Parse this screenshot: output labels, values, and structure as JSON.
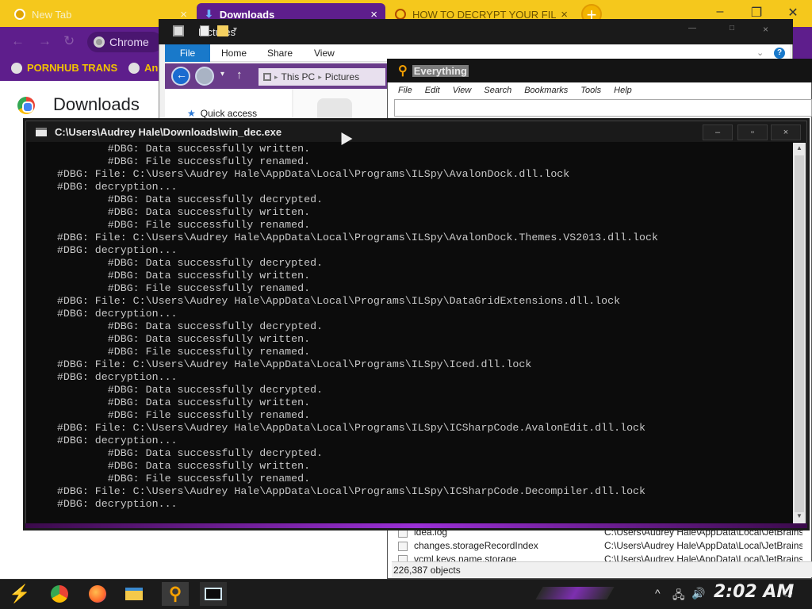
{
  "chrome": {
    "tabs": [
      {
        "label": "New Tab"
      },
      {
        "label": "Downloads"
      },
      {
        "label": "HOW TO DECRYPT YOUR FIL"
      }
    ],
    "omnibox_label": "Chrome",
    "bookmarks": [
      {
        "label": "PORNHUB TRANS"
      },
      {
        "label": "An"
      }
    ],
    "page_title": "Downloads",
    "accent_color": "#5e1e8c",
    "tabbar_color": "#f5c81c"
  },
  "explorer": {
    "title": "Pictures",
    "ribbon_tabs": [
      "File",
      "Home",
      "Share",
      "View"
    ],
    "breadcrumb": [
      "This PC",
      "Pictures"
    ],
    "nav_quick_access": "Quick access"
  },
  "everything": {
    "title": "Everything",
    "menu": [
      "File",
      "Edit",
      "View",
      "Search",
      "Bookmarks",
      "Tools",
      "Help"
    ],
    "rows": [
      {
        "name": "idea.log",
        "path": "C:\\Users\\Audrey Hale\\AppData\\Local\\JetBrains\\..."
      },
      {
        "name": "changes.storageRecordIndex",
        "path": "C:\\Users\\Audrey Hale\\AppData\\Local\\JetBrains\\..."
      },
      {
        "name": "vcml.keys.name.storage",
        "path": "C:\\Users\\Audrey Hale\\AppData\\Local\\JetBrains\\..."
      }
    ],
    "status": "226,387 objects"
  },
  "console": {
    "title": "C:\\Users\\Audrey Hale\\Downloads\\win_dec.exe",
    "buttons": {
      "minimize": "–",
      "maximize": "▫",
      "close": "×"
    },
    "lines": [
      "            #DBG: Data successfully written.",
      "            #DBG: File successfully renamed.",
      "    #DBG: File: C:\\Users\\Audrey Hale\\AppData\\Local\\Programs\\ILSpy\\AvalonDock.dll.lock",
      "    #DBG: decryption...",
      "            #DBG: Data successfully decrypted.",
      "            #DBG: Data successfully written.",
      "            #DBG: File successfully renamed.",
      "    #DBG: File: C:\\Users\\Audrey Hale\\AppData\\Local\\Programs\\ILSpy\\AvalonDock.Themes.VS2013.dll.lock",
      "    #DBG: decryption...",
      "            #DBG: Data successfully decrypted.",
      "            #DBG: Data successfully written.",
      "            #DBG: File successfully renamed.",
      "    #DBG: File: C:\\Users\\Audrey Hale\\AppData\\Local\\Programs\\ILSpy\\DataGridExtensions.dll.lock",
      "    #DBG: decryption...",
      "            #DBG: Data successfully decrypted.",
      "            #DBG: Data successfully written.",
      "            #DBG: File successfully renamed.",
      "    #DBG: File: C:\\Users\\Audrey Hale\\AppData\\Local\\Programs\\ILSpy\\Iced.dll.lock",
      "    #DBG: decryption...",
      "            #DBG: Data successfully decrypted.",
      "            #DBG: Data successfully written.",
      "            #DBG: File successfully renamed.",
      "    #DBG: File: C:\\Users\\Audrey Hale\\AppData\\Local\\Programs\\ILSpy\\ICSharpCode.AvalonEdit.dll.lock",
      "    #DBG: decryption...",
      "            #DBG: Data successfully decrypted.",
      "            #DBG: Data successfully written.",
      "            #DBG: File successfully renamed.",
      "    #DBG: File: C:\\Users\\Audrey Hale\\AppData\\Local\\Programs\\ILSpy\\ICSharpCode.Decompiler.dll.lock",
      "    #DBG: decryption..."
    ]
  },
  "taskbar": {
    "clock": "2:02 AM",
    "icons": [
      "start-icon",
      "chrome-icon",
      "firefox-icon",
      "file-explorer-icon",
      "everything-icon",
      "console-icon"
    ]
  }
}
